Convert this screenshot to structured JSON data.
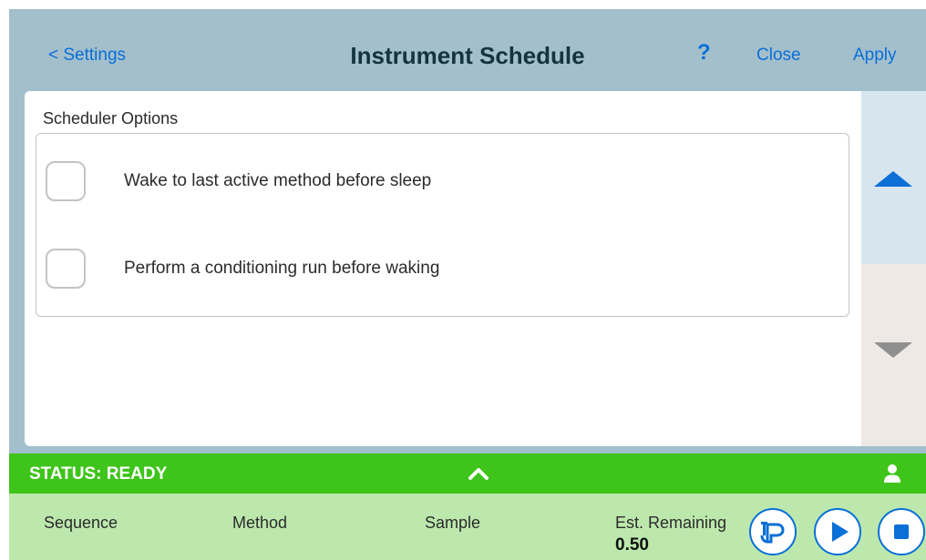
{
  "header": {
    "back_label": "< Settings",
    "title": "Instrument Schedule",
    "help_label": "?",
    "close_label": "Close",
    "apply_label": "Apply"
  },
  "scheduler": {
    "section_title": "Scheduler Options",
    "options": [
      {
        "label": "Wake to last active method before sleep",
        "checked": false
      },
      {
        "label": "Perform a conditioning run before waking",
        "checked": false
      }
    ]
  },
  "scroll": {
    "up_icon": "triangle-up-icon",
    "down_icon": "triangle-down-icon"
  },
  "status": {
    "text": "STATUS: READY",
    "expand_icon": "chevron-up-icon",
    "user_icon": "user-icon"
  },
  "info": {
    "sequence_label": "Sequence",
    "method_label": "Method",
    "sample_label": "Sample",
    "est_remaining_label": "Est. Remaining",
    "est_remaining_value": "0.50"
  },
  "controls": {
    "prime_icon": "prime-icon",
    "play_icon": "play-icon",
    "stop_icon": "stop-icon"
  },
  "colors": {
    "header_bg": "#a3bfcc",
    "accent": "#0a6fd6",
    "status_bar": "#3ec41a",
    "info_bar": "#bde8ad",
    "scroll_up_bg": "#d6e5ee",
    "scroll_down_bg": "#efe9e6"
  }
}
